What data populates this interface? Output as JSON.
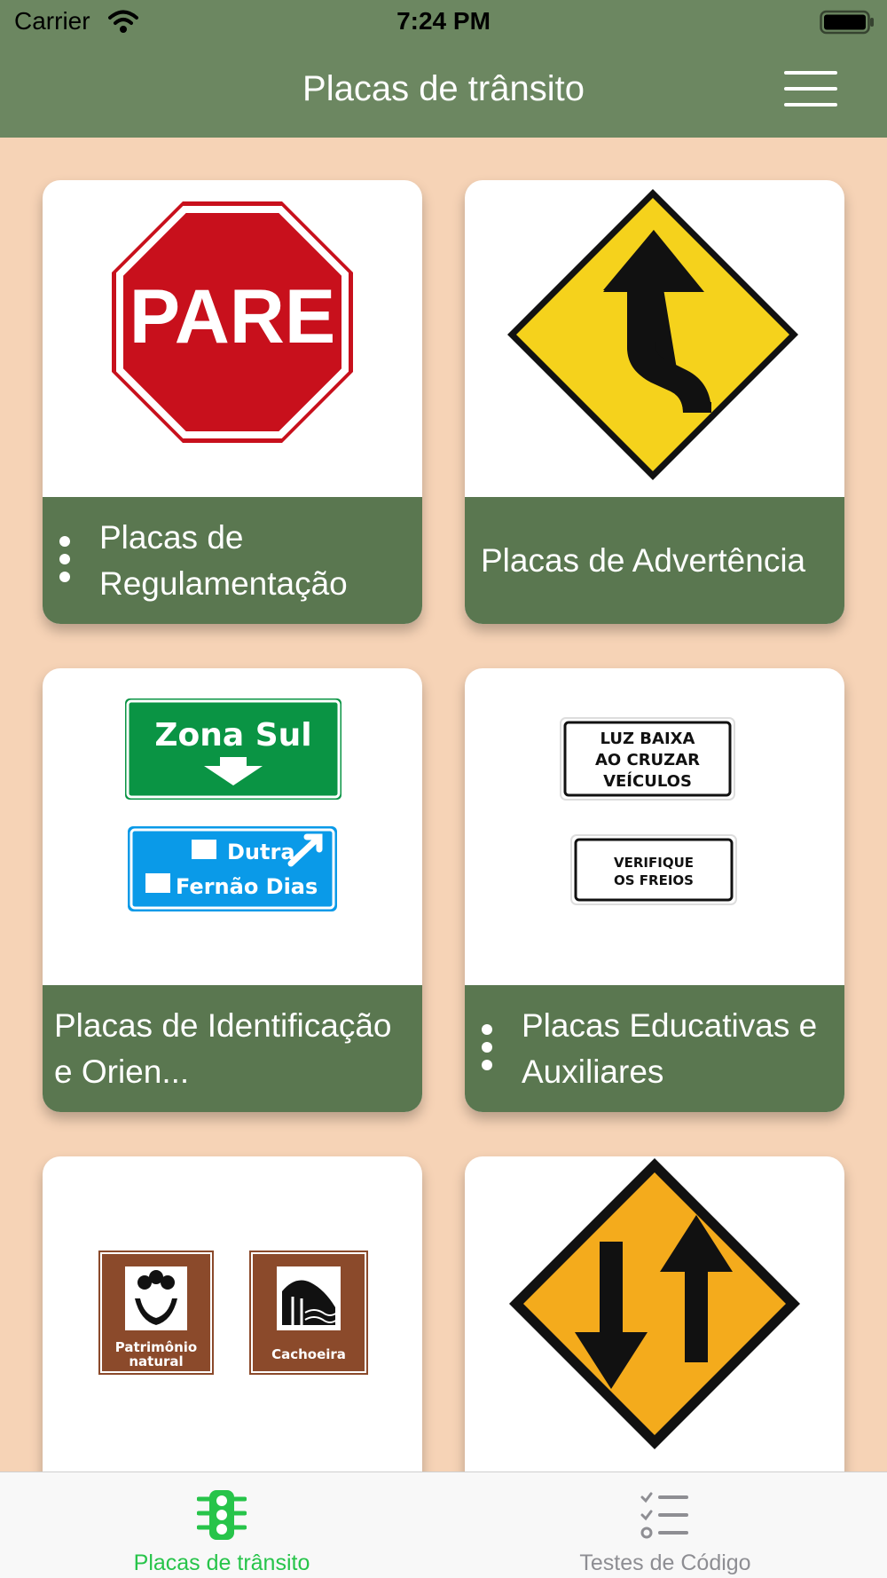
{
  "status_bar": {
    "carrier": "Carrier",
    "time": "7:24 PM"
  },
  "header": {
    "title": "Placas de trânsito"
  },
  "cards": [
    {
      "label": "Placas de Regulamentação",
      "sign_text": "PARE"
    },
    {
      "label": "Placas de Advertência"
    },
    {
      "label": "Placas de Identificação e Orien...",
      "sign_text_1": "Zona Sul",
      "sign_text_2": "Dutra",
      "sign_text_3": "Fernão Dias"
    },
    {
      "label": "Placas Educativas e Auxiliares",
      "sign_text_1": "LUZ BAIXA",
      "sign_text_2": "AO CRUZAR",
      "sign_text_3": "VEÍCULOS",
      "sign_text_4": "VERIFIQUE",
      "sign_text_5": "OS FREIOS"
    },
    {
      "sign_text_1": "Patrimônio",
      "sign_text_2": "natural",
      "sign_text_3": "Cachoeira"
    },
    {}
  ],
  "tabs": [
    {
      "label": "Placas de trânsito",
      "icon": "traffic-light-icon",
      "active": true
    },
    {
      "label": "Testes de Código",
      "icon": "checklist-icon",
      "active": false
    }
  ],
  "colors": {
    "header": "#6c8761",
    "background": "#f6d3b6",
    "card_footer": "#5a7750",
    "tab_active": "#27c44a",
    "tab_inactive": "#8e8e93"
  }
}
